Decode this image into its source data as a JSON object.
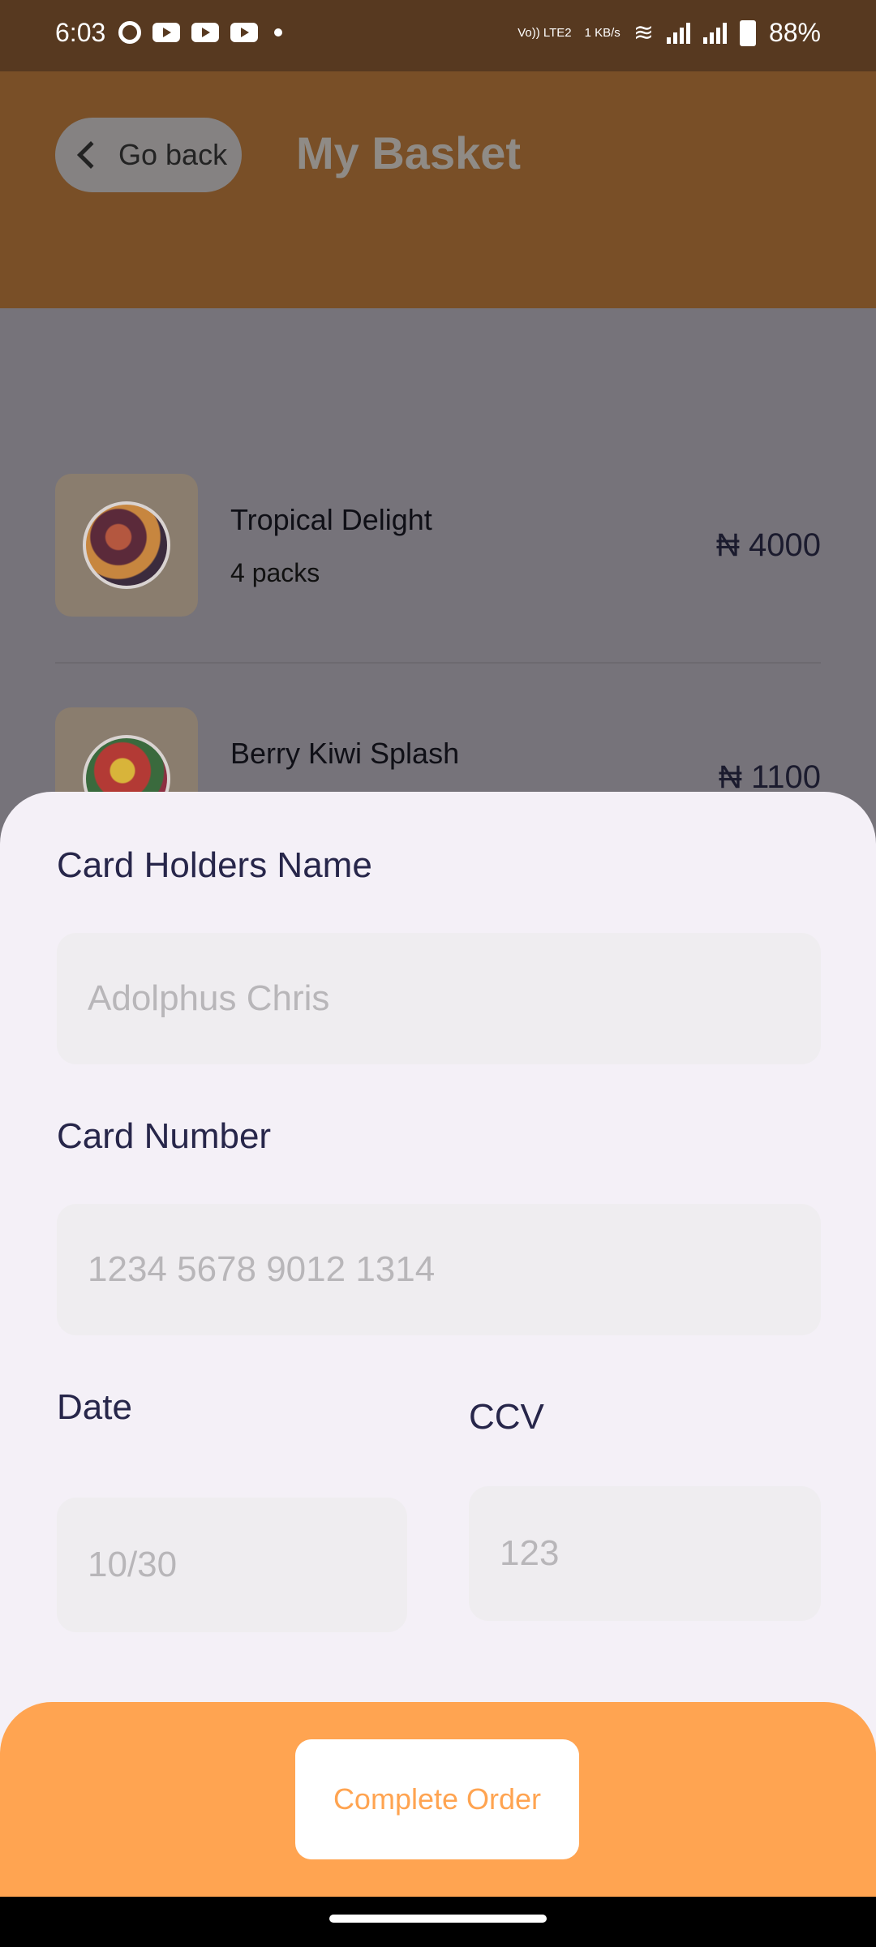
{
  "status_bar": {
    "time": "6:03",
    "network_top": "Vo)) LTE2",
    "speed": "1 KB/s",
    "battery": "88%"
  },
  "header": {
    "back_label": "Go back",
    "title": "My Basket"
  },
  "basket": {
    "items": [
      {
        "name": "Tropical Delight",
        "qty": "4 packs",
        "price": "₦ 4000"
      },
      {
        "name": "Berry Kiwi Splash",
        "price": "₦ 1100"
      }
    ]
  },
  "payment": {
    "holder_label": "Card Holders Name",
    "holder_placeholder": "Adolphus Chris",
    "number_label": "Card Number",
    "number_placeholder": "1234 5678 9012 1314",
    "date_label": "Date",
    "date_placeholder": "10/30",
    "ccv_label": "CCV",
    "ccv_placeholder": "123"
  },
  "footer": {
    "button_label": "Complete Order"
  },
  "colors": {
    "accent": "#ffa451",
    "header": "#794f27",
    "label": "#27264a"
  }
}
